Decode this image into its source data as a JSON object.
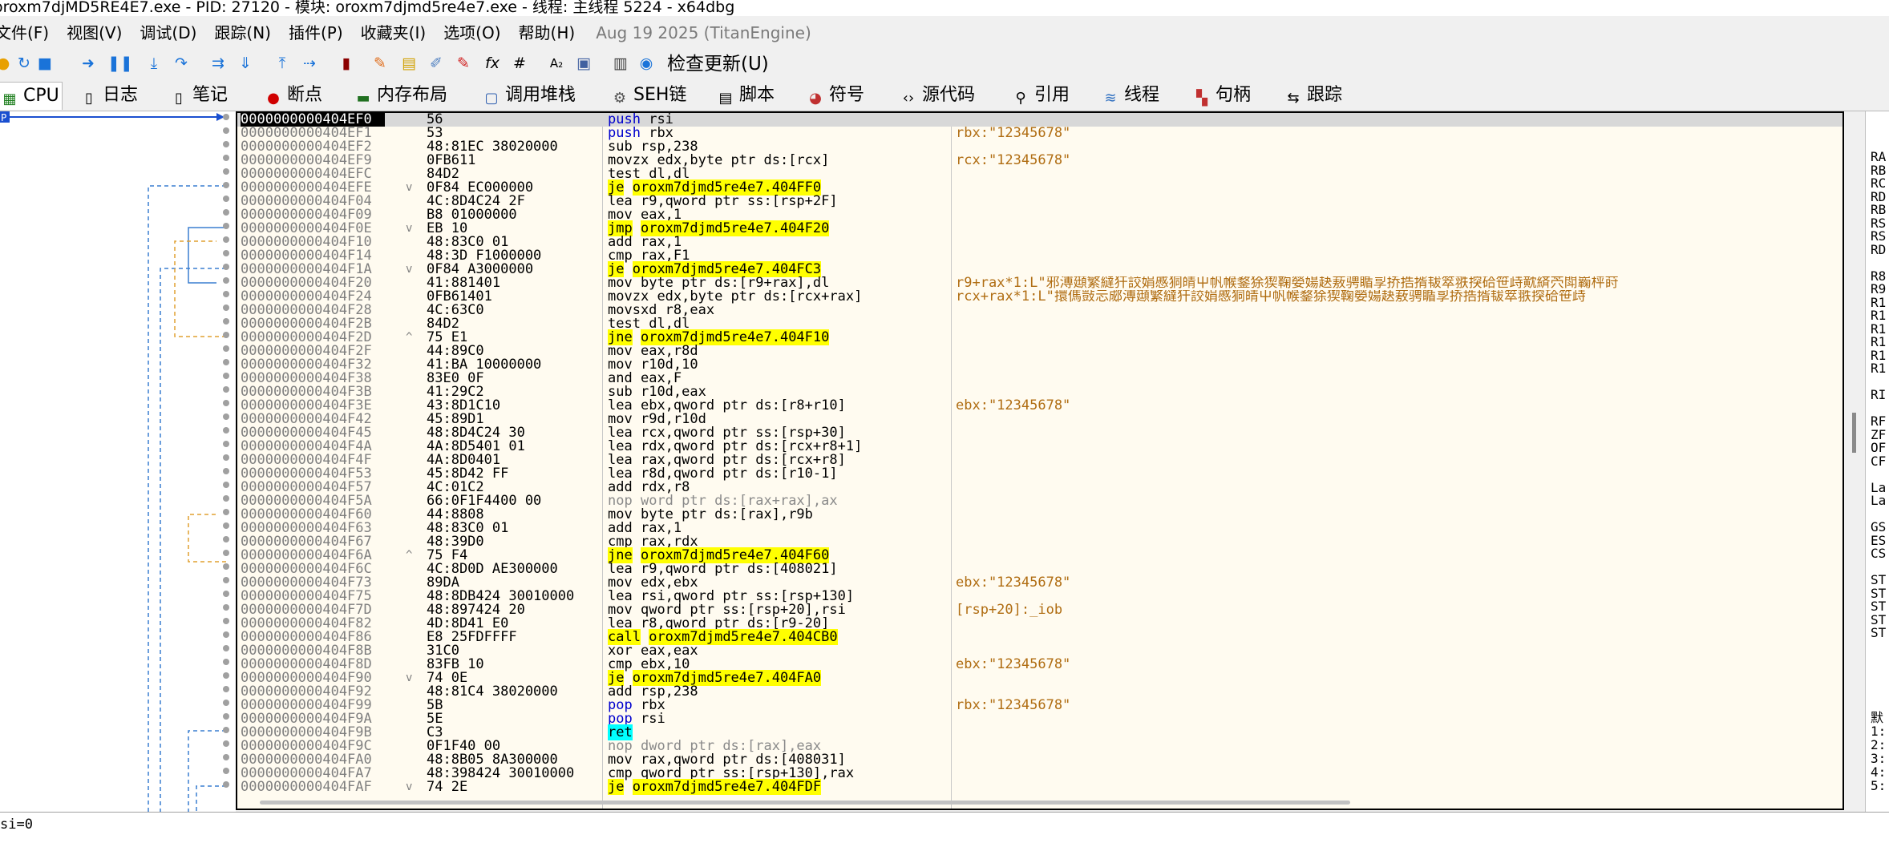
{
  "window_title": "oroxm7djMD5RE4E7.exe - PID: 27120 - 模块: oroxm7djmd5re4e7.exe - 线程: 主线程 5224 - x64dbg",
  "menu": [
    "文件(F)",
    "视图(V)",
    "调试(D)",
    "跟踪(N)",
    "插件(P)",
    "收藏夹(I)",
    "选项(O)",
    "帮助(H)"
  ],
  "build_date": "Aug 19 2025 (TitanEngine)",
  "toolbar": {
    "check_update": "检查更新(U)",
    "fx": "fx",
    "hash": "#",
    "az": "A₂"
  },
  "tabs": [
    {
      "label": "CPU",
      "icon": "cpu-icon"
    },
    {
      "label": "日志",
      "icon": "log-icon"
    },
    {
      "label": "笔记",
      "icon": "notes-icon"
    },
    {
      "label": "断点",
      "icon": "breakpoint-icon"
    },
    {
      "label": "内存布局",
      "icon": "memory-map-icon"
    },
    {
      "label": "调用堆栈",
      "icon": "call-stack-icon"
    },
    {
      "label": "SEH链",
      "icon": "seh-icon"
    },
    {
      "label": "脚本",
      "icon": "script-icon"
    },
    {
      "label": "符号",
      "icon": "symbols-icon"
    },
    {
      "label": "源代码",
      "icon": "source-icon"
    },
    {
      "label": "引用",
      "icon": "references-icon"
    },
    {
      "label": "线程",
      "icon": "threads-icon"
    },
    {
      "label": "句柄",
      "icon": "handles-icon"
    },
    {
      "label": "跟踪",
      "icon": "trace-icon"
    }
  ],
  "rip_label": "P",
  "rows": [
    {
      "addr": "0000000000404EF0",
      "bytes": "56",
      "mnem": "push",
      "ops": "rsi",
      "cmt": "",
      "cur": true
    },
    {
      "addr": "0000000000404EF1",
      "bytes": "53",
      "mnem": "push",
      "ops": "rbx",
      "cmt": "rbx:\"12345678\""
    },
    {
      "addr": "0000000000404EF2",
      "bytes": "48:81EC 38020000",
      "mnem": "sub",
      "ops": "rsp,238",
      "cmt": ""
    },
    {
      "addr": "0000000000404EF9",
      "bytes": "0FB611",
      "mnem": "movzx",
      "ops": "edx,byte ptr ds:[rcx]",
      "cmt": "rcx:\"12345678\""
    },
    {
      "addr": "0000000000404EFC",
      "bytes": "84D2",
      "mnem": "test",
      "ops": "dl,dl",
      "cmt": ""
    },
    {
      "addr": "0000000000404EFE",
      "bytes": "0F84 EC000000",
      "mnem": "je",
      "ops": "oroxm7djmd5re4e7.404FF0",
      "cmt": "",
      "jump": true,
      "mark": "v"
    },
    {
      "addr": "0000000000404F04",
      "bytes": "4C:8D4C24 2F",
      "mnem": "lea",
      "ops": "r9,qword ptr ss:[rsp+2F]",
      "cmt": ""
    },
    {
      "addr": "0000000000404F09",
      "bytes": "B8 01000000",
      "mnem": "mov",
      "ops": "eax,1",
      "cmt": ""
    },
    {
      "addr": "0000000000404F0E",
      "bytes": "EB 10",
      "mnem": "jmp",
      "ops": "oroxm7djmd5re4e7.404F20",
      "cmt": "",
      "jump": true,
      "mark": "v"
    },
    {
      "addr": "0000000000404F10",
      "bytes": "48:83C0 01",
      "mnem": "add",
      "ops": "rax,1",
      "cmt": ""
    },
    {
      "addr": "0000000000404F14",
      "bytes": "48:3D F1000000",
      "mnem": "cmp",
      "ops": "rax,F1",
      "cmt": ""
    },
    {
      "addr": "0000000000404F1A",
      "bytes": "0F84 A3000000",
      "mnem": "je",
      "ops": "oroxm7djmd5re4e7.404FC3",
      "cmt": "",
      "jump": true,
      "mark": "v"
    },
    {
      "addr": "0000000000404F20",
      "bytes": "41:881401",
      "mnem": "mov",
      "ops": "byte ptr ds:[r9+rax],dl",
      "cmt": "r9+rax*1:L\"邪溥頲繁繨犴詨娟慼狪皘屮帆帿鍪狳猰鞠嫈婸赽蔜骋瞃孠挢捁揟韨箤翐揬硆笹歭黆緕茓閗巈枰莳"
    },
    {
      "addr": "0000000000404F24",
      "bytes": "0FB61401",
      "mnem": "movzx",
      "ops": "edx,byte ptr ds:[rcx+rax]",
      "cmt": "rcx+rax*1:L\"擐傌敱忈郕溥頲繁繨犴詨娟慼狪皘屮帆帿鍪狳猰鞠嫈婸赽蔜骋瞃孠挢捁揟韨箤翐揬硆笹歭"
    },
    {
      "addr": "0000000000404F28",
      "bytes": "4C:63C0",
      "mnem": "movsxd",
      "ops": "r8,eax",
      "cmt": ""
    },
    {
      "addr": "0000000000404F2B",
      "bytes": "84D2",
      "mnem": "test",
      "ops": "dl,dl",
      "cmt": ""
    },
    {
      "addr": "0000000000404F2D",
      "bytes": "75 E1",
      "mnem": "jne",
      "ops": "oroxm7djmd5re4e7.404F10",
      "cmt": "",
      "jump": true,
      "mark": "^"
    },
    {
      "addr": "0000000000404F2F",
      "bytes": "44:89C0",
      "mnem": "mov",
      "ops": "eax,r8d",
      "cmt": ""
    },
    {
      "addr": "0000000000404F32",
      "bytes": "41:BA 10000000",
      "mnem": "mov",
      "ops": "r10d,10",
      "cmt": ""
    },
    {
      "addr": "0000000000404F38",
      "bytes": "83E0 0F",
      "mnem": "and",
      "ops": "eax,F",
      "cmt": ""
    },
    {
      "addr": "0000000000404F3B",
      "bytes": "41:29C2",
      "mnem": "sub",
      "ops": "r10d,eax",
      "cmt": ""
    },
    {
      "addr": "0000000000404F3E",
      "bytes": "43:8D1C10",
      "mnem": "lea",
      "ops": "ebx,qword ptr ds:[r8+r10]",
      "cmt": "ebx:\"12345678\""
    },
    {
      "addr": "0000000000404F42",
      "bytes": "45:89D1",
      "mnem": "mov",
      "ops": "r9d,r10d",
      "cmt": ""
    },
    {
      "addr": "0000000000404F45",
      "bytes": "48:8D4C24 30",
      "mnem": "lea",
      "ops": "rcx,qword ptr ss:[rsp+30]",
      "cmt": ""
    },
    {
      "addr": "0000000000404F4A",
      "bytes": "4A:8D5401 01",
      "mnem": "lea",
      "ops": "rdx,qword ptr ds:[rcx+r8+1]",
      "cmt": ""
    },
    {
      "addr": "0000000000404F4F",
      "bytes": "4A:8D0401",
      "mnem": "lea",
      "ops": "rax,qword ptr ds:[rcx+r8]",
      "cmt": ""
    },
    {
      "addr": "0000000000404F53",
      "bytes": "45:8D42 FF",
      "mnem": "lea",
      "ops": "r8d,qword ptr ds:[r10-1]",
      "cmt": ""
    },
    {
      "addr": "0000000000404F57",
      "bytes": "4C:01C2",
      "mnem": "add",
      "ops": "rdx,r8",
      "cmt": ""
    },
    {
      "addr": "0000000000404F5A",
      "bytes": "66:0F1F4400 00",
      "mnem": "nop",
      "ops": "word ptr ds:[rax+rax],ax",
      "cmt": "",
      "gray": true
    },
    {
      "addr": "0000000000404F60",
      "bytes": "44:8808",
      "mnem": "mov",
      "ops": "byte ptr ds:[rax],r9b",
      "cmt": ""
    },
    {
      "addr": "0000000000404F63",
      "bytes": "48:83C0 01",
      "mnem": "add",
      "ops": "rax,1",
      "cmt": ""
    },
    {
      "addr": "0000000000404F67",
      "bytes": "48:39D0",
      "mnem": "cmp",
      "ops": "rax,rdx",
      "cmt": ""
    },
    {
      "addr": "0000000000404F6A",
      "bytes": "75 F4",
      "mnem": "jne",
      "ops": "oroxm7djmd5re4e7.404F60",
      "cmt": "",
      "jump": true,
      "mark": "^"
    },
    {
      "addr": "0000000000404F6C",
      "bytes": "4C:8D0D AE300000",
      "mnem": "lea",
      "ops": "r9,qword ptr ds:[408021]",
      "cmt": ""
    },
    {
      "addr": "0000000000404F73",
      "bytes": "89DA",
      "mnem": "mov",
      "ops": "edx,ebx",
      "cmt": "ebx:\"12345678\""
    },
    {
      "addr": "0000000000404F75",
      "bytes": "48:8DB424 30010000",
      "mnem": "lea",
      "ops": "rsi,qword ptr ss:[rsp+130]",
      "cmt": ""
    },
    {
      "addr": "0000000000404F7D",
      "bytes": "48:897424 20",
      "mnem": "mov",
      "ops": "qword ptr ss:[rsp+20],rsi",
      "cmt": "[rsp+20]:_iob"
    },
    {
      "addr": "0000000000404F82",
      "bytes": "4D:8D41 E0",
      "mnem": "lea",
      "ops": "r8,qword ptr ds:[r9-20]",
      "cmt": ""
    },
    {
      "addr": "0000000000404F86",
      "bytes": "E8 25FDFFFF",
      "mnem": "call",
      "ops": "oroxm7djmd5re4e7.404CB0",
      "cmt": "",
      "call": true
    },
    {
      "addr": "0000000000404F8B",
      "bytes": "31C0",
      "mnem": "xor",
      "ops": "eax,eax",
      "cmt": ""
    },
    {
      "addr": "0000000000404F8D",
      "bytes": "83FB 10",
      "mnem": "cmp",
      "ops": "ebx,10",
      "cmt": "ebx:\"12345678\""
    },
    {
      "addr": "0000000000404F90",
      "bytes": "74 0E",
      "mnem": "je",
      "ops": "oroxm7djmd5re4e7.404FA0",
      "cmt": "",
      "jump": true,
      "mark": "v"
    },
    {
      "addr": "0000000000404F92",
      "bytes": "48:81C4 38020000",
      "mnem": "add",
      "ops": "rsp,238",
      "cmt": ""
    },
    {
      "addr": "0000000000404F99",
      "bytes": "5B",
      "mnem": "pop",
      "ops": "rbx",
      "cmt": "rbx:\"12345678\"",
      "pop": true
    },
    {
      "addr": "0000000000404F9A",
      "bytes": "5E",
      "mnem": "pop",
      "ops": "rsi",
      "cmt": "",
      "pop": true
    },
    {
      "addr": "0000000000404F9B",
      "bytes": "C3",
      "mnem": "ret",
      "ops": "",
      "cmt": "",
      "ret": true
    },
    {
      "addr": "0000000000404F9C",
      "bytes": "0F1F40 00",
      "mnem": "nop",
      "ops": "dword ptr ds:[rax],eax",
      "cmt": "",
      "gray": true
    },
    {
      "addr": "0000000000404FA0",
      "bytes": "48:8B05 8A300000",
      "mnem": "mov",
      "ops": "rax,qword ptr ds:[408031]",
      "cmt": ""
    },
    {
      "addr": "0000000000404FA7",
      "bytes": "48:398424 30010000",
      "mnem": "cmp",
      "ops": "qword ptr ss:[rsp+130],rax",
      "cmt": ""
    },
    {
      "addr": "0000000000404FAF",
      "bytes": "74 2E",
      "mnem": "je",
      "ops": "oroxm7djmd5re4e7.404FDF",
      "cmt": "",
      "jump": true,
      "mark": "v"
    }
  ],
  "regs_partial": [
    "RA",
    "RB",
    "RC",
    "RD",
    "RB",
    "RS",
    "RS",
    "RD",
    "",
    "R8",
    "R9",
    "R1",
    "R1",
    "R1",
    "R1",
    "R1",
    "R1",
    "",
    "RI",
    "",
    "RF",
    "ZF",
    "OF",
    "CF",
    "",
    "La",
    "La",
    "",
    "GS",
    "ES",
    "CS",
    "",
    "ST",
    "ST",
    "ST",
    "ST",
    "ST"
  ],
  "stack_partial": [
    "默",
    "1:",
    "2:",
    "3:",
    "4:",
    "5:"
  ],
  "status_text": "si=0",
  "colors": {
    "jump_highlight": "#ffff00",
    "call_highlight": "#ffff00",
    "ret_highlight": "#00ffff",
    "comment": "#b06d12",
    "address": "#808080",
    "background": "#fffbf0"
  }
}
